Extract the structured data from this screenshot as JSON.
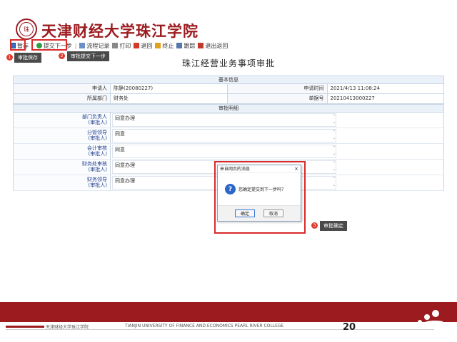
{
  "header": {
    "school_name": "天津财经大学珠江学院",
    "seal_char": "珠"
  },
  "toolbar": {
    "items": [
      {
        "label": "暂存",
        "icon": "save-icon"
      },
      {
        "label": "提交下一步",
        "icon": "next-icon"
      },
      {
        "label": "流程记录",
        "icon": "document-icon"
      },
      {
        "label": "打印",
        "icon": "print-icon"
      },
      {
        "label": "退回",
        "icon": "close-icon"
      },
      {
        "label": "终止",
        "icon": "flag-icon"
      },
      {
        "label": "跟踪",
        "icon": "monitor-icon"
      },
      {
        "label": "退出返回",
        "icon": "exit-icon"
      }
    ]
  },
  "annotations": {
    "tip1": "审批保存",
    "tip2": "审批提交下一步",
    "tip3": "审批确定",
    "badge1": "1",
    "badge2": "2",
    "badge3": "3"
  },
  "form": {
    "title": "珠江经营业务事项审批",
    "basic_section": "基本信息",
    "applicant_label": "申请人",
    "applicant_value": "陈静(20080227)",
    "apply_time_label": "申请时间",
    "apply_time_value": "2021/4/13 11:08:24",
    "dept_label": "所属部门",
    "dept_value": "财务处",
    "doc_no_label": "单据号",
    "doc_no_value": "20210413000227",
    "opinion_section": "审批明细",
    "opinions": [
      {
        "label_line1": "部门负责人",
        "label_line2": "(审批人)",
        "value": "同意办理"
      },
      {
        "label_line1": "分管领导",
        "label_line2": "(审批人)",
        "value": "同意"
      },
      {
        "label_line1": "会计审核",
        "label_line2": "(审批人)",
        "value": "同意"
      },
      {
        "label_line1": "财务处审核",
        "label_line2": "(审批人)",
        "value": "同意办理"
      },
      {
        "label_line1": "财务领导",
        "label_line2": "(审批人)",
        "value": "同意办理"
      }
    ]
  },
  "dialog": {
    "title": "来自网页的消息",
    "close": "×",
    "message": "您确定提交到下一步吗？",
    "ok_label": "确定",
    "cancel_label": "取消"
  },
  "footer": {
    "cn": "天津财经大学珠江学院",
    "en": "TIANJIN UNIVERSITY OF FINANCE AND ECONOMICS PEARL RIVER COLLEGE",
    "page": "20"
  },
  "colors": {
    "brand": "#9b1b1f",
    "highlight": "#d92a2a",
    "section": "#eaf1f8"
  }
}
